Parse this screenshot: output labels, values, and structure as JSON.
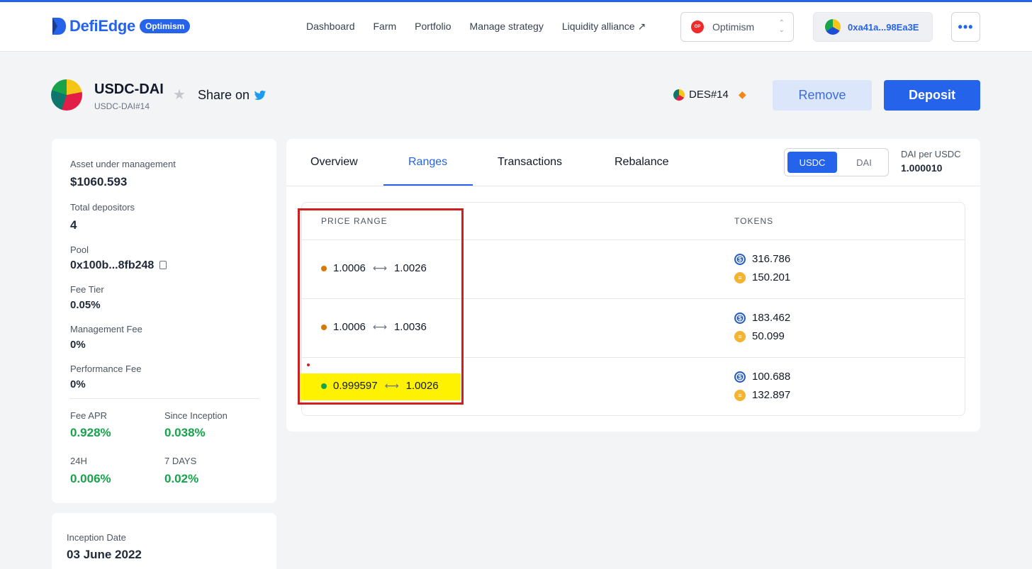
{
  "header": {
    "brand": "DefiEdge",
    "brand_badge": "Optimism",
    "nav": [
      "Dashboard",
      "Farm",
      "Portfolio",
      "Manage strategy",
      "Liquidity alliance ↗"
    ],
    "network": {
      "icon_text": "OP",
      "label": "Optimism"
    },
    "wallet": "0xa41a...98Ea3E",
    "more": "•••"
  },
  "pool": {
    "title": "USDC-DAI",
    "subtitle": "USDC-DAI#14",
    "share_label": "Share on",
    "strategy": "DES#14",
    "remove_label": "Remove",
    "deposit_label": "Deposit"
  },
  "stats": {
    "aum_label": "Asset under management",
    "aum_value": "$1060.593",
    "depositors_label": "Total depositors",
    "depositors_value": "4",
    "pool_label": "Pool",
    "pool_value": "0x100b...8fb248",
    "fee_tier_label": "Fee Tier",
    "fee_tier_value": "0.05%",
    "mgmt_fee_label": "Management Fee",
    "mgmt_fee_value": "0%",
    "perf_fee_label": "Performance Fee",
    "perf_fee_value": "0%",
    "fee_apr_label": "Fee APR",
    "fee_apr_value": "0.928%",
    "inception_pct_label": "Since Inception",
    "inception_pct_value": "0.038%",
    "h24_label": "24H",
    "h24_value": "0.006%",
    "d7_label": "7 DAYS",
    "d7_value": "0.02%"
  },
  "inception": {
    "label": "Inception Date",
    "value": "03 June 2022"
  },
  "tabs": [
    "Overview",
    "Ranges",
    "Transactions",
    "Rebalance"
  ],
  "active_tab": "Ranges",
  "token_toggle": {
    "options": [
      "USDC",
      "DAI"
    ],
    "selected": "USDC"
  },
  "price": {
    "label": "DAI per USDC",
    "value": "1.000010"
  },
  "table": {
    "headers": [
      "PRICE RANGE",
      "TOKENS"
    ],
    "rows": [
      {
        "low": "1.0006",
        "high": "1.0026",
        "status_color": "#d97706",
        "usdc": "316.786",
        "dai": "150.201"
      },
      {
        "low": "1.0006",
        "high": "1.0036",
        "status_color": "#d97706",
        "usdc": "183.462",
        "dai": "50.099"
      },
      {
        "low": "0.999597",
        "high": "1.0026",
        "status_color": "#16a34a",
        "usdc": "100.688",
        "dai": "132.897"
      }
    ]
  },
  "colors": {
    "accent": "#2563eb",
    "positive": "#16a34a",
    "annotation": "#d01f1f",
    "highlight": "#fff200"
  }
}
